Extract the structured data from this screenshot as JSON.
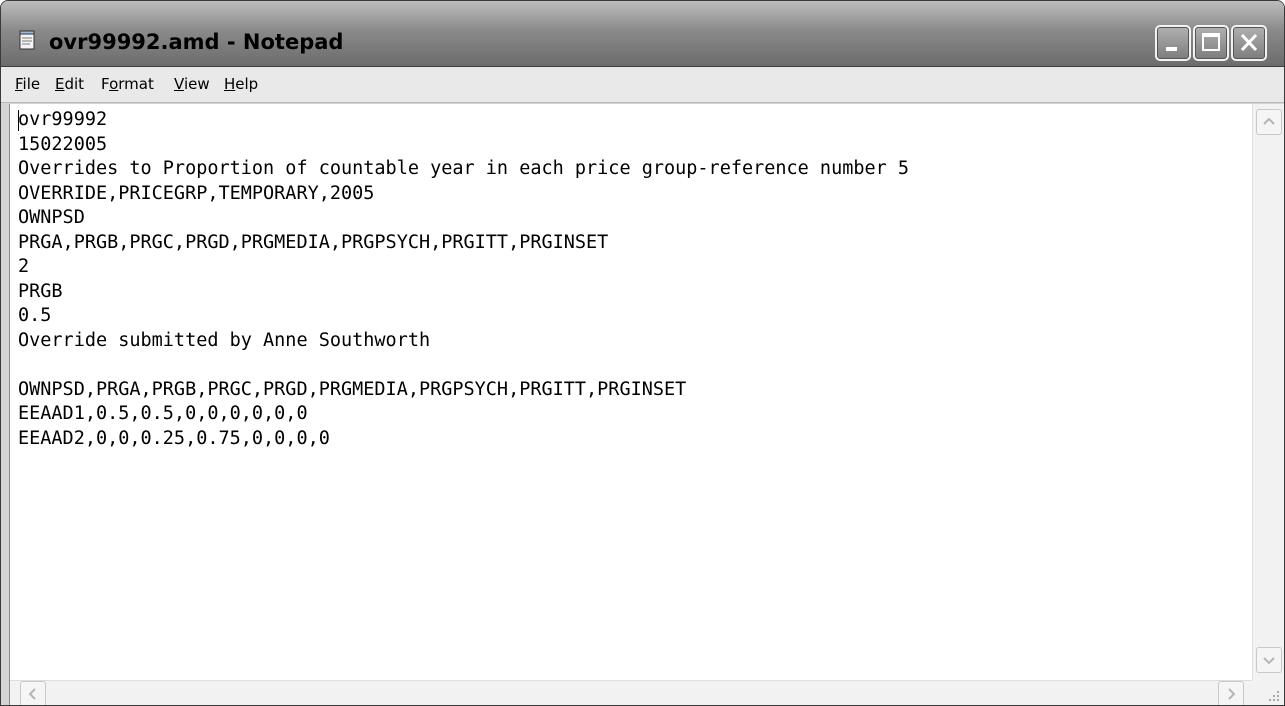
{
  "window": {
    "title": "ovr99992.amd - Notepad"
  },
  "menu": {
    "items": [
      {
        "first": "F",
        "rest": "ile"
      },
      {
        "first": "E",
        "rest": "dit"
      },
      {
        "pre": "F",
        "first": "o",
        "rest": "rmat"
      },
      {
        "first": "V",
        "rest": "iew"
      },
      {
        "first": "H",
        "rest": "elp"
      }
    ]
  },
  "editor": {
    "lines": [
      "ovr99992",
      "15022005",
      "Overrides to Proportion of countable year in each price group-reference number 5",
      "OVERRIDE,PRICEGRP,TEMPORARY,2005",
      "OWNPSD",
      "PRGA,PRGB,PRGC,PRGD,PRGMEDIA,PRGPSYCH,PRGITT,PRGINSET",
      "2",
      "PRGB",
      "0.5",
      "Override submitted by Anne Southworth",
      "",
      "OWNPSD,PRGA,PRGB,PRGC,PRGD,PRGMEDIA,PRGPSYCH,PRGITT,PRGINSET",
      "EEAAD1,0.5,0.5,0,0,0,0,0,0",
      "EEAAD2,0,0,0.25,0.75,0,0,0,0"
    ]
  },
  "icons": {
    "app": "notepad-icon",
    "minimize": "minimize-icon",
    "maximize": "maximize-icon",
    "close": "close-icon",
    "scroll_up": "arrow-up-icon",
    "scroll_down": "arrow-down-icon",
    "scroll_left": "arrow-left-icon",
    "scroll_right": "arrow-right-icon",
    "size_grip": "size-grip-icon"
  }
}
